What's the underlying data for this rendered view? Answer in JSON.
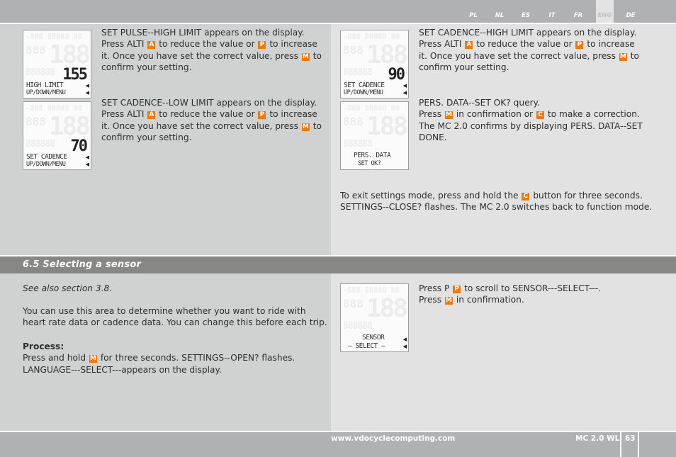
{
  "header": {
    "languages": [
      "PL",
      "NL",
      "ES",
      "IT",
      "FR",
      "ENG",
      "DE"
    ],
    "active_language": "ENG"
  },
  "keys": {
    "alti": "A",
    "plus": "P",
    "menu": "M",
    "clear": "C"
  },
  "top_left": {
    "block1": {
      "lines": [
        "SET PULSE--HIGH LIMIT appears on the display.",
        "Press ALTI",
        "to reduce the value or",
        "to increase",
        "it. Once you have set the correct value, press",
        "to",
        "confirm your setting."
      ],
      "display": {
        "value": "155",
        "line1": "HIGH LIMIT",
        "line2": "UP/DOWN/MENU"
      }
    },
    "block2": {
      "lines": [
        "SET CADENCE--LOW LIMIT appears on the display.",
        "Press ALTI",
        "to reduce the value or",
        "to increase",
        "it. Once you have set the correct value, press",
        "to",
        "confirm your setting."
      ],
      "display": {
        "value": "70",
        "line1": "SET CADENCE",
        "line2": "UP/DOWN/MENU"
      }
    }
  },
  "top_right": {
    "block1": {
      "lines": [
        "SET CADENCE--HIGH LIMIT appears on the display.",
        "Press ALTI",
        "to reduce the value or",
        "to increase",
        "it. Once you have set the correct value, press",
        "to",
        "confirm your setting."
      ],
      "display": {
        "value": "90",
        "line1": "SET CADENCE",
        "line2": "UP/DOWN/MENU"
      }
    },
    "block2": {
      "lines": [
        "PERS. DATA--SET OK? query.",
        "Press",
        "in confirmation or",
        "to make a correction.",
        "The MC 2.0 confirms by displaying PERS. DATA--SET",
        "DONE."
      ],
      "display": {
        "value": "",
        "line1": "PERS. DATA",
        "line2": "SET OK?"
      }
    },
    "exit": {
      "lines": [
        "To exit settings mode, press and hold the",
        "button for three seconds.",
        "SETTINGS--CLOSE? flashes. The MC 2.0 switches back to function mode."
      ]
    }
  },
  "section": {
    "title": "6.5 Selecting a sensor",
    "see_also": "See also section 3.8.",
    "intro": [
      "You can use this area to determine whether you want to ride with",
      "heart rate data or cadence data. You can change this before each trip."
    ],
    "process_label": "Process:",
    "process": [
      "Press and hold",
      "for three seconds. SETTINGS--OPEN? flashes.",
      "LANGUAGE---SELECT---appears on the display."
    ],
    "right": {
      "lines": [
        "Press P",
        "to scroll to SENSOR---SELECT---.",
        "Press",
        "in confirmation."
      ],
      "display": {
        "line1": "SENSOR",
        "line2": "SELECT"
      }
    }
  },
  "footer": {
    "url": "www.vdocyclecomputing.com",
    "model": "MC 2.0 WL",
    "page": "63"
  },
  "colors": {
    "key_orange": "#ec7a12",
    "section_bar": "#878785",
    "top_bar": "#b0b1b3"
  }
}
